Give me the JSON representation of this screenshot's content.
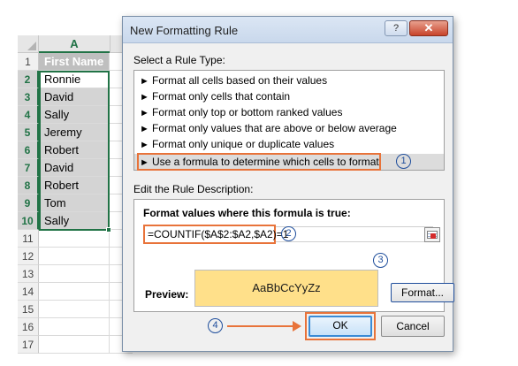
{
  "spreadsheet": {
    "column_header": "A",
    "row_numbers": [
      "1",
      "2",
      "3",
      "4",
      "5",
      "6",
      "7",
      "8",
      "9",
      "10",
      "11",
      "12",
      "13",
      "14",
      "15",
      "16",
      "17"
    ],
    "header_cell": "First Name",
    "names": [
      "Ronnie",
      "David",
      "Sally",
      "Jeremy",
      "Robert",
      "David",
      "Robert",
      "Tom",
      "Sally"
    ]
  },
  "dialog": {
    "title": "New Formatting Rule",
    "help_label": "?",
    "close_label": "✕",
    "select_rule_type_label": "Select a Rule Type:",
    "rule_types": [
      "Format all cells based on their values",
      "Format only cells that contain",
      "Format only top or bottom ranked values",
      "Format only values that are above or below average",
      "Format only unique or duplicate values",
      "Use a formula to determine which cells to format"
    ],
    "selected_rule_index": 5,
    "edit_description_label": "Edit the Rule Description:",
    "formula_label": "Format values where this formula is true:",
    "formula_value": "=COUNTIF($A$2:$A2,$A2)=1",
    "preview_label": "Preview:",
    "preview_sample": "AaBbCcYyZz",
    "preview_fill_color": "#ffe08a",
    "format_button": "Format...",
    "ok_button": "OK",
    "cancel_button": "Cancel"
  },
  "callouts": {
    "step1": "1",
    "step2": "2",
    "step3": "3",
    "step4": "4",
    "accent_color": "#e8733a",
    "circle_color": "#1f4e9c"
  }
}
